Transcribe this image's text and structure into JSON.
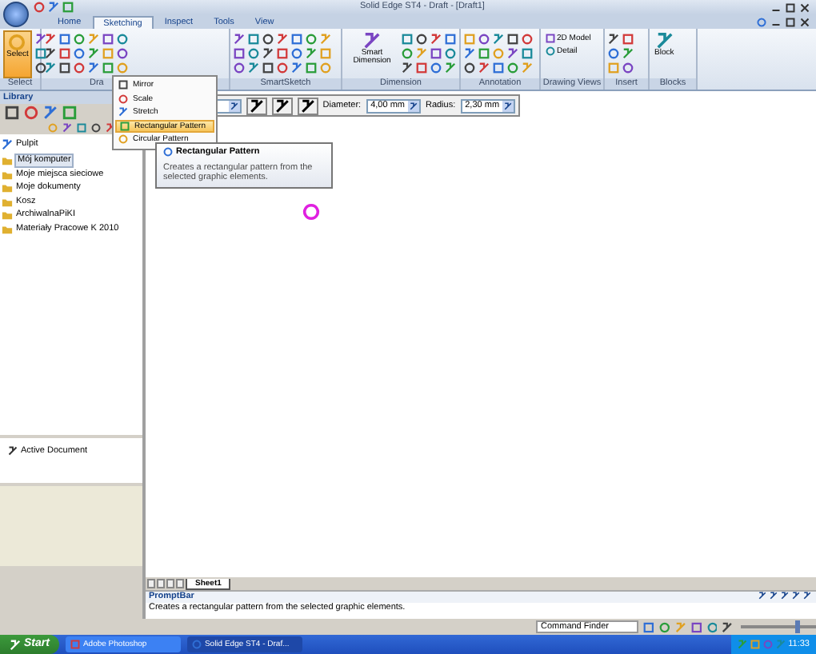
{
  "window": {
    "title": "Solid Edge ST4 - Draft - [Draft1]"
  },
  "ribbon_tabs": [
    {
      "label": "Home",
      "selected": false
    },
    {
      "label": "Sketching",
      "selected": true
    },
    {
      "label": "Inspect",
      "selected": false
    },
    {
      "label": "Tools",
      "selected": false
    },
    {
      "label": "View",
      "selected": false
    }
  ],
  "ribbon_groups": [
    {
      "label": "Select",
      "big_button": "Select"
    },
    {
      "label": "Dra"
    },
    {
      "label": "SmartSketch"
    },
    {
      "label": "Dimension",
      "big_button": "Smart Dimension"
    },
    {
      "label": "Annotation"
    },
    {
      "label": "Drawing Views",
      "buttons": [
        "2D Model",
        "Detail"
      ]
    },
    {
      "label": "Insert"
    },
    {
      "label": "Blocks",
      "big_button": "Block"
    }
  ],
  "dropdown_menu": [
    {
      "label": "Mirror",
      "selected": false
    },
    {
      "label": "Scale",
      "selected": false
    },
    {
      "label": "Stretch",
      "selected": false
    },
    {
      "label": "Rectangular Pattern",
      "selected": true
    },
    {
      "label": "Circular Pattern",
      "selected": false
    }
  ],
  "tooltip": {
    "title": "Rectangular Pattern",
    "text": "Creates a rectangular pattern from the selected graphic elements."
  },
  "command_bar": {
    "fields": [
      {
        "label": "Diameter:",
        "value": "4,00 mm"
      },
      {
        "label": "Radius:",
        "value": "2,30 mm"
      }
    ]
  },
  "library": {
    "title": "Library",
    "tree": [
      {
        "label": "Pulpit",
        "selected": false,
        "children": [
          {
            "label": "Mój komputer",
            "selected": true
          },
          {
            "label": "Moje miejsca sieciowe",
            "selected": false
          },
          {
            "label": "Moje dokumenty",
            "selected": false
          },
          {
            "label": "Kosz",
            "selected": false
          },
          {
            "label": "ArchiwalnaPiKI",
            "selected": false
          },
          {
            "label": "Materiały Pracowe K 2010",
            "selected": false
          }
        ]
      }
    ],
    "active_document": "Active Document"
  },
  "sheet_tabs": [
    {
      "label": "Sheet1",
      "selected": true
    }
  ],
  "prompt_bar": {
    "title": "PromptBar",
    "text": "Creates a rectangular pattern from the selected graphic elements."
  },
  "status_bar": {
    "command_finder": "Command Finder",
    "zoom_slider": {
      "level": 0.75
    }
  },
  "taskbar": {
    "start": "Start",
    "apps": [
      {
        "label": "Adobe Photoshop",
        "selected": false
      },
      {
        "label": "Solid Edge ST4 - Draf...",
        "selected": true
      }
    ],
    "clock": "11:33"
  }
}
